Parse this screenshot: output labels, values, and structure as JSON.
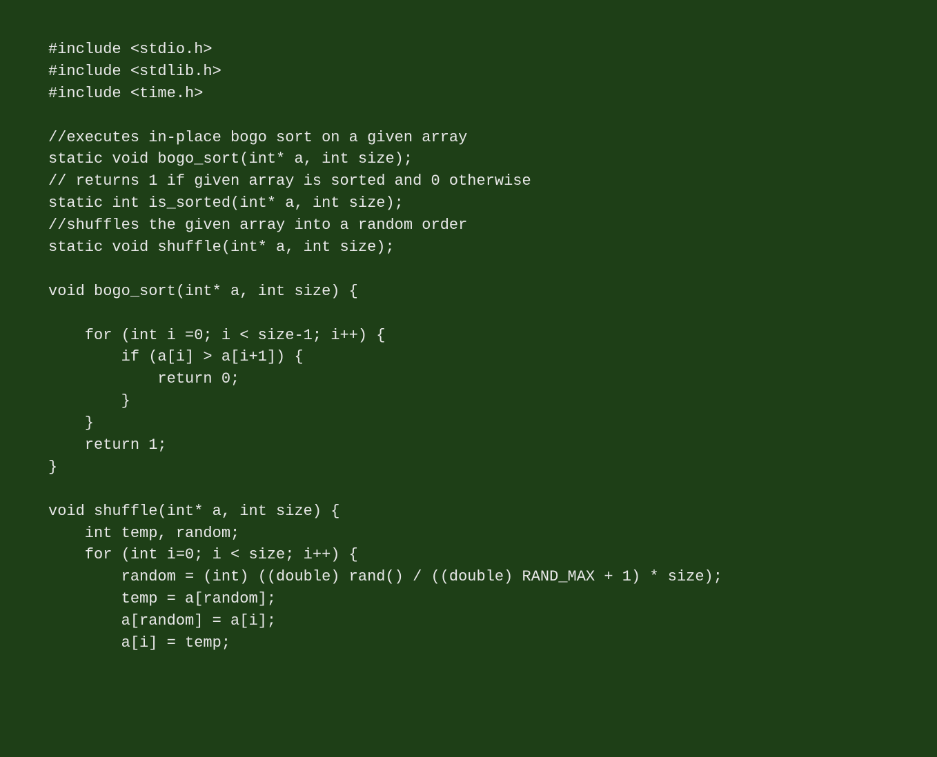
{
  "code": {
    "lines": [
      "#include <stdio.h>",
      "#include <stdlib.h>",
      "#include <time.h>",
      "",
      "//executes in-place bogo sort on a given array",
      "static void bogo_sort(int* a, int size);",
      "// returns 1 if given array is sorted and 0 otherwise",
      "static int is_sorted(int* a, int size);",
      "//shuffles the given array into a random order",
      "static void shuffle(int* a, int size);",
      "",
      "void bogo_sort(int* a, int size) {",
      "",
      "    for (int i =0; i < size-1; i++) {",
      "        if (a[i] > a[i+1]) {",
      "            return 0;",
      "        }",
      "    }",
      "    return 1;",
      "}",
      "",
      "void shuffle(int* a, int size) {",
      "    int temp, random;",
      "    for (int i=0; i < size; i++) {",
      "        random = (int) ((double) rand() / ((double) RAND_MAX + 1) * size);",
      "        temp = a[random];",
      "        a[random] = a[i];",
      "        a[i] = temp;"
    ]
  }
}
